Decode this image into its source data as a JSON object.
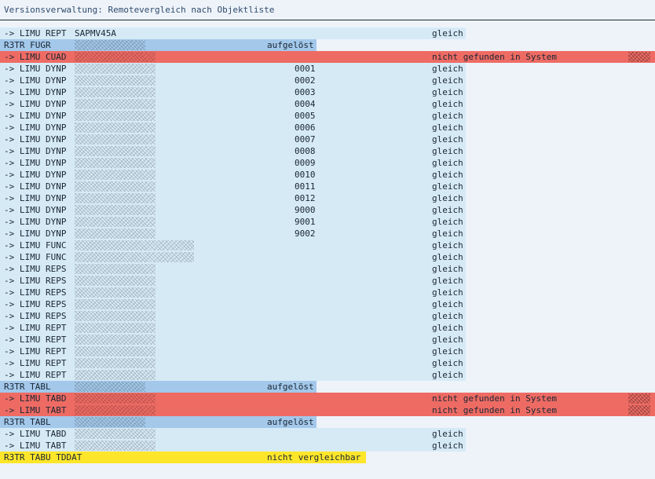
{
  "window": {
    "title": "Versionsverwaltung: Remotevergleich nach Objektliste"
  },
  "rows": [
    {
      "kind": "obj",
      "type": "-> LIMU REPT",
      "name": "SAPMV45A",
      "sub": "",
      "status": "gleich"
    },
    {
      "kind": "grp",
      "type": "R3TR FUGR",
      "name": "",
      "sub": "",
      "status": "aufgelöst"
    },
    {
      "kind": "err",
      "type": "-> LIMU CUAD",
      "name": "",
      "sub": "",
      "status": "nicht gefunden in System"
    },
    {
      "kind": "obj",
      "type": "-> LIMU DYNP",
      "name": "",
      "sub": "0001",
      "status": "gleich"
    },
    {
      "kind": "obj",
      "type": "-> LIMU DYNP",
      "name": "",
      "sub": "0002",
      "status": "gleich"
    },
    {
      "kind": "obj",
      "type": "-> LIMU DYNP",
      "name": "",
      "sub": "0003",
      "status": "gleich"
    },
    {
      "kind": "obj",
      "type": "-> LIMU DYNP",
      "name": "",
      "sub": "0004",
      "status": "gleich"
    },
    {
      "kind": "obj",
      "type": "-> LIMU DYNP",
      "name": "",
      "sub": "0005",
      "status": "gleich"
    },
    {
      "kind": "obj",
      "type": "-> LIMU DYNP",
      "name": "",
      "sub": "0006",
      "status": "gleich"
    },
    {
      "kind": "obj",
      "type": "-> LIMU DYNP",
      "name": "",
      "sub": "0007",
      "status": "gleich"
    },
    {
      "kind": "obj",
      "type": "-> LIMU DYNP",
      "name": "",
      "sub": "0008",
      "status": "gleich"
    },
    {
      "kind": "obj",
      "type": "-> LIMU DYNP",
      "name": "",
      "sub": "0009",
      "status": "gleich"
    },
    {
      "kind": "obj",
      "type": "-> LIMU DYNP",
      "name": "",
      "sub": "0010",
      "status": "gleich"
    },
    {
      "kind": "obj",
      "type": "-> LIMU DYNP",
      "name": "",
      "sub": "0011",
      "status": "gleich"
    },
    {
      "kind": "obj",
      "type": "-> LIMU DYNP",
      "name": "",
      "sub": "0012",
      "status": "gleich"
    },
    {
      "kind": "obj",
      "type": "-> LIMU DYNP",
      "name": "",
      "sub": "9000",
      "status": "gleich"
    },
    {
      "kind": "obj",
      "type": "-> LIMU DYNP",
      "name": "",
      "sub": "9001",
      "status": "gleich"
    },
    {
      "kind": "obj",
      "type": "-> LIMU DYNP",
      "name": "",
      "sub": "9002",
      "status": "gleich"
    },
    {
      "kind": "obj",
      "type": "-> LIMU FUNC",
      "name": "",
      "sub": "",
      "status": "gleich"
    },
    {
      "kind": "obj",
      "type": "-> LIMU FUNC",
      "name": "",
      "sub": "",
      "status": "gleich"
    },
    {
      "kind": "obj",
      "type": "-> LIMU REPS",
      "name": "",
      "sub": "",
      "status": "gleich"
    },
    {
      "kind": "obj",
      "type": "-> LIMU REPS",
      "name": "",
      "sub": "",
      "status": "gleich"
    },
    {
      "kind": "obj",
      "type": "-> LIMU REPS",
      "name": "",
      "sub": "",
      "status": "gleich"
    },
    {
      "kind": "obj",
      "type": "-> LIMU REPS",
      "name": "",
      "sub": "",
      "status": "gleich"
    },
    {
      "kind": "obj",
      "type": "-> LIMU REPS",
      "name": "",
      "sub": "",
      "status": "gleich"
    },
    {
      "kind": "obj",
      "type": "-> LIMU REPT",
      "name": "",
      "sub": "",
      "status": "gleich"
    },
    {
      "kind": "obj",
      "type": "-> LIMU REPT",
      "name": "",
      "sub": "",
      "status": "gleich"
    },
    {
      "kind": "obj",
      "type": "-> LIMU REPT",
      "name": "",
      "sub": "",
      "status": "gleich"
    },
    {
      "kind": "obj",
      "type": "-> LIMU REPT",
      "name": "",
      "sub": "",
      "status": "gleich"
    },
    {
      "kind": "obj",
      "type": "-> LIMU REPT",
      "name": "",
      "sub": "",
      "status": "gleich"
    },
    {
      "kind": "grp",
      "type": "R3TR TABL",
      "name": "",
      "sub": "",
      "status": "aufgelöst"
    },
    {
      "kind": "err",
      "type": "-> LIMU TABD",
      "name": "",
      "sub": "",
      "status": "nicht gefunden in System"
    },
    {
      "kind": "err",
      "type": "-> LIMU TABT",
      "name": "",
      "sub": "",
      "status": "nicht gefunden in System"
    },
    {
      "kind": "grp",
      "type": "R3TR TABL",
      "name": "",
      "sub": "",
      "status": "aufgelöst"
    },
    {
      "kind": "obj",
      "type": "-> LIMU TABD",
      "name": "",
      "sub": "",
      "status": "gleich"
    },
    {
      "kind": "obj",
      "type": "-> LIMU TABT",
      "name": "",
      "sub": "",
      "status": "gleich"
    },
    {
      "kind": "warn",
      "type": "R3TR TABU TDDAT",
      "name": "",
      "sub": "",
      "status": "nicht vergleichbar"
    }
  ]
}
